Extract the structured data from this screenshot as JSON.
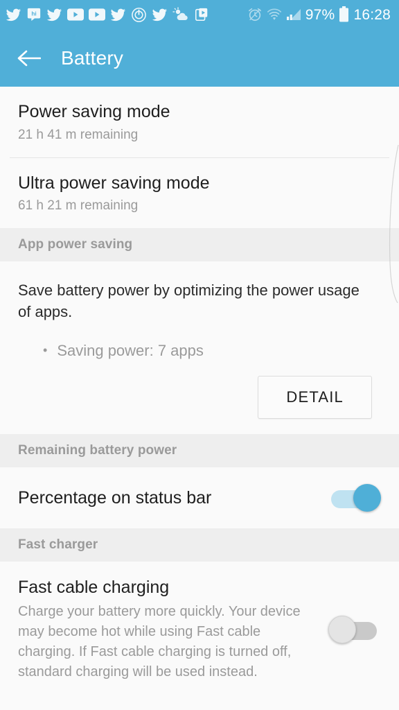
{
  "status_bar": {
    "notification_icons": [
      "twitter-bird-icon",
      "hike-message-icon",
      "twitter-bird-icon",
      "youtube-icon",
      "youtube-icon",
      "twitter-bird-icon",
      "power-target-icon",
      "twitter-bird-icon",
      "weather-sun-cloud-icon",
      "media-clipboard-icon"
    ],
    "alarm_icon": "alarm-clock-icon",
    "wifi_icon": "wifi-icon",
    "signal_icon": "signal-bars-icon",
    "battery_percent": "97%",
    "battery_icon": "battery-full-icon",
    "clock": "16:28"
  },
  "app_bar": {
    "back_icon": "back-arrow-icon",
    "title": "Battery"
  },
  "colors": {
    "accent": "#50AFD8",
    "toggle_on": "#4FAFD7",
    "toggle_on_track": "#bfe2f1",
    "toggle_off_track": "#c9c9c9",
    "section_header_bg": "#eeeeee",
    "page_bg": "#fafafa"
  },
  "settings": {
    "power_saving_mode": {
      "title": "Power saving mode",
      "subtitle": "21 h 41 m remaining"
    },
    "ultra_power_saving_mode": {
      "title": "Ultra power saving mode",
      "subtitle": "61 h 21 m remaining"
    },
    "app_power_saving": {
      "section_header": "App power saving",
      "description": "Save battery power by optimizing the power usage of apps.",
      "bullet_dot": "•",
      "bullet_text": "Saving power: 7 apps",
      "detail_button": "DETAIL"
    },
    "remaining_battery_power": {
      "section_header": "Remaining battery power",
      "percentage_on_status_bar": {
        "label": "Percentage on status bar",
        "state": "on"
      }
    },
    "fast_charger": {
      "section_header": "Fast charger",
      "fast_cable_charging": {
        "label": "Fast cable charging",
        "description": "Charge your battery more quickly. Your device may become hot while using Fast cable charging. If Fast cable charging is turned off, standard charging will be used instead.",
        "state": "off"
      }
    }
  }
}
